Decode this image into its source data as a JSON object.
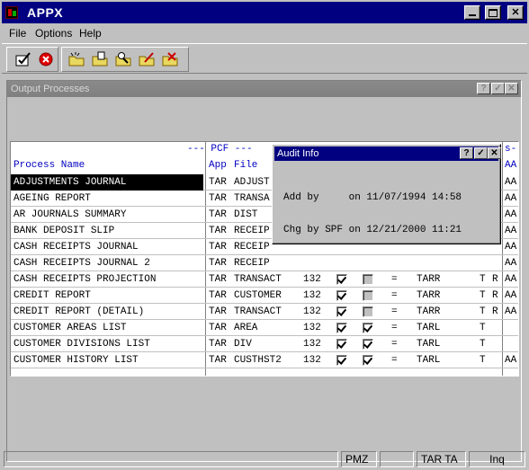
{
  "window": {
    "title": "APPX"
  },
  "menu": [
    "File",
    "Options",
    "Help"
  ],
  "toolbar": {
    "buttons": [
      "ok-icon",
      "cancel-icon",
      "new-folder-icon",
      "open-folder-icon",
      "find-folder-icon",
      "edit-folder-icon",
      "delete-folder-icon"
    ]
  },
  "child": {
    "title": "Output Processes",
    "help": "?",
    "ok": "✓",
    "close": "✕"
  },
  "grid": {
    "col_process_name": "Process Name",
    "pcf_group": "--- PCF ---",
    "col_app": "App",
    "col_file": "File",
    "right_header_top": "s-",
    "right_header": "AA",
    "rows": [
      {
        "name": "ADJUSTMENTS JOURNAL",
        "app": "TAR",
        "file": "ADJUST",
        "right": "AA",
        "selected": true,
        "partial": true
      },
      {
        "name": "AGEING REPORT",
        "app": "TAR",
        "file": "TRANSA",
        "right": "AA",
        "partial": true
      },
      {
        "name": "AR JOURNALS SUMMARY",
        "app": "TAR",
        "file": "DIST",
        "right": "AA",
        "partial": true
      },
      {
        "name": "BANK DEPOSIT SLIP",
        "app": "TAR",
        "file": "RECEIP",
        "right": "AA",
        "partial": true
      },
      {
        "name": "CASH RECEIPTS JOURNAL",
        "app": "TAR",
        "file": "RECEIP",
        "right": "AA",
        "partial": true
      },
      {
        "name": "CASH RECEIPTS JOURNAL 2",
        "app": "TAR",
        "file": "RECEIP",
        "right": "AA",
        "partial": true
      },
      {
        "name": "CASH RECEIPTS PROJECTION",
        "app": "TAR",
        "file": "TRANSACT",
        "width": "132",
        "c1": true,
        "c2": false,
        "eq": "=",
        "code": "TARR",
        "t": "T",
        "r": "R",
        "right": "AA"
      },
      {
        "name": "CREDIT REPORT",
        "app": "TAR",
        "file": "CUSTOMER",
        "width": "132",
        "c1": true,
        "c2": false,
        "eq": "=",
        "code": "TARR",
        "t": "T",
        "r": "R",
        "right": "AA"
      },
      {
        "name": "CREDIT REPORT (DETAIL)",
        "app": "TAR",
        "file": "TRANSACT",
        "width": "132",
        "c1": true,
        "c2": false,
        "eq": "=",
        "code": "TARR",
        "t": "T",
        "r": "R",
        "right": "AA"
      },
      {
        "name": "CUSTOMER AREAS LIST",
        "app": "TAR",
        "file": "AREA",
        "width": "132",
        "c1": true,
        "c2": true,
        "eq": "=",
        "code": "TARL",
        "t": "T",
        "r": "",
        "right": ""
      },
      {
        "name": "CUSTOMER DIVISIONS LIST",
        "app": "TAR",
        "file": "DIV",
        "width": "132",
        "c1": true,
        "c2": true,
        "eq": "=",
        "code": "TARL",
        "t": "T",
        "r": "",
        "right": ""
      },
      {
        "name": "CUSTOMER HISTORY LIST",
        "app": "TAR",
        "file": "CUSTHST2",
        "width": "132",
        "c1": true,
        "c2": true,
        "eq": "=",
        "code": "TARL",
        "t": "T",
        "r": "",
        "right": "AA"
      }
    ]
  },
  "audit": {
    "title": "Audit Info",
    "help": "?",
    "ok": "✓",
    "close": "✕",
    "line1": "Add by     on 11/07/1994 14:58",
    "line2": "Chg by SPF on 12/21/2000 11:21"
  },
  "status": {
    "panels": [
      "PMZ",
      "TAR TA",
      "Inq"
    ]
  }
}
